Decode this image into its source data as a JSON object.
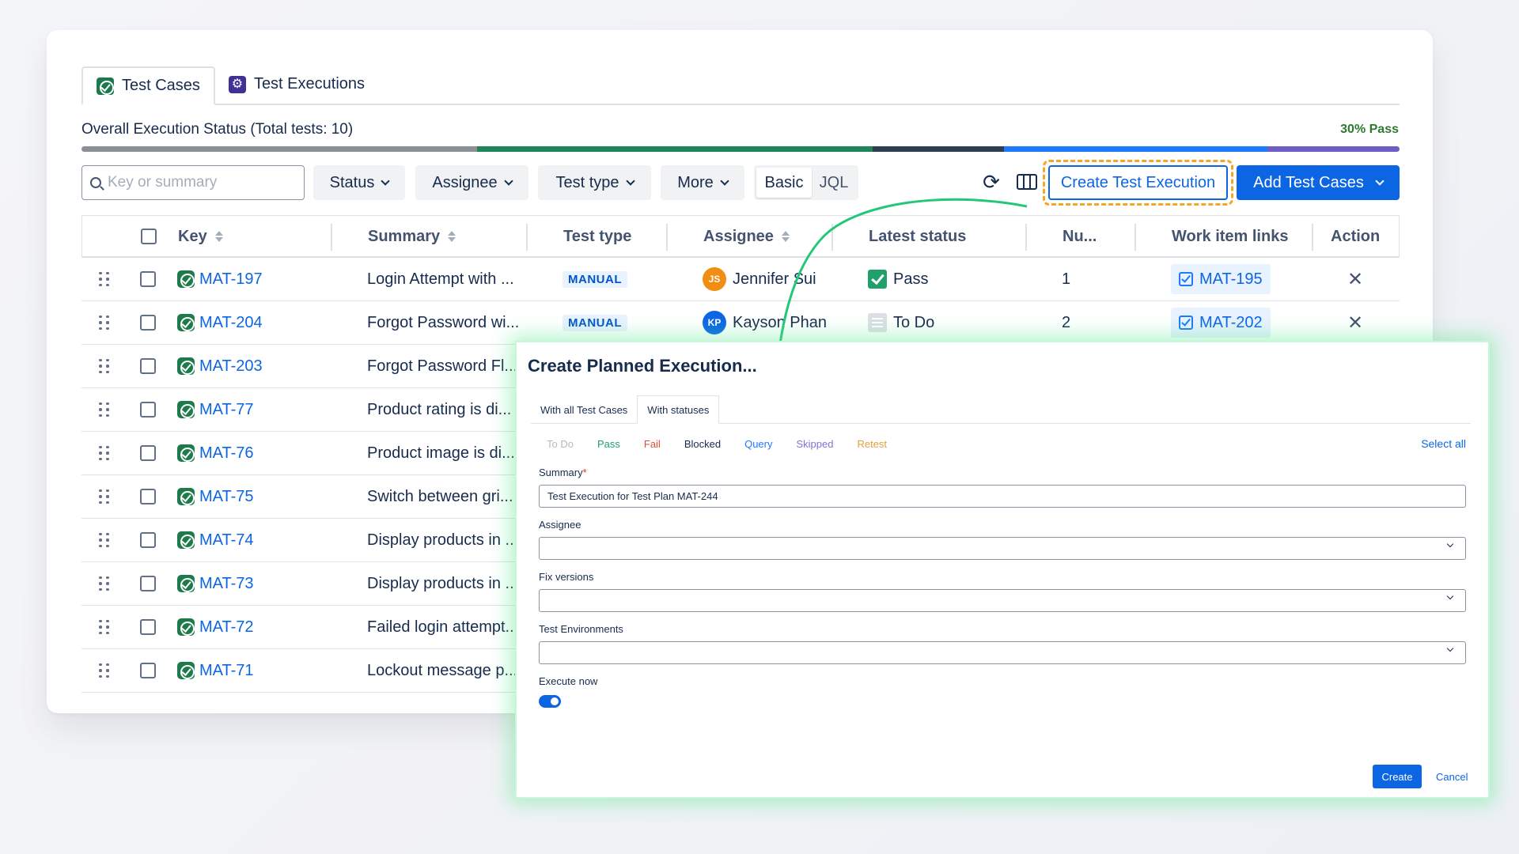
{
  "tabs": [
    {
      "label": "Test Cases"
    },
    {
      "label": "Test Executions"
    }
  ],
  "overall_status": "Overall Execution Status (Total tests: 10)",
  "pass_percent_text": "30% Pass",
  "progress": {
    "segments": [
      {
        "fraction": 0.3,
        "color": "#8c8f96"
      },
      {
        "fraction": 0.3,
        "color": "#1f845a"
      },
      {
        "fraction": 0.1,
        "color": "#2c3e50"
      },
      {
        "fraction": 0.2,
        "color": "#1d7afc"
      },
      {
        "fraction": 0.1,
        "color": "#6e5dc6"
      }
    ]
  },
  "toolbar": {
    "search_placeholder": "Key or summary",
    "status_label": "Status",
    "assignee_label": "Assignee",
    "test_type_label": "Test type",
    "more_label": "More",
    "basic_label": "Basic",
    "jql_label": "JQL",
    "create_execution_label": "Create Test Execution",
    "add_test_cases_label": "Add Test Cases"
  },
  "table": {
    "headers": {
      "key": "Key",
      "summary": "Summary",
      "test_type": "Test type",
      "assignee": "Assignee",
      "latest_status": "Latest status",
      "number": "Nu...",
      "work_item_links": "Work item links",
      "action": "Action"
    },
    "rows": [
      {
        "key": "MAT-197",
        "summary": "Login Attempt with ...",
        "test_type": "MANUAL",
        "assignee_initials": "JS",
        "assignee": "Jennifer Sui",
        "avatar_color": "#f18d13",
        "status": "Pass",
        "number": "1",
        "link": "MAT-195"
      },
      {
        "key": "MAT-204",
        "summary": "Forgot Password wi...",
        "test_type": "MANUAL",
        "assignee_initials": "KP",
        "assignee": "Kayson Phan",
        "avatar_color": "#0c66e4",
        "status": "To Do",
        "number": "2",
        "link": "MAT-202"
      },
      {
        "key": "MAT-203",
        "summary": "Forgot Password Fl..."
      },
      {
        "key": "MAT-77",
        "summary": "Product rating is di..."
      },
      {
        "key": "MAT-76",
        "summary": "Product image is di..."
      },
      {
        "key": "MAT-75",
        "summary": "Switch between gri..."
      },
      {
        "key": "MAT-74",
        "summary": "Display products in ..."
      },
      {
        "key": "MAT-73",
        "summary": "Display products in ..."
      },
      {
        "key": "MAT-72",
        "summary": "Failed login attempt..."
      },
      {
        "key": "MAT-71",
        "summary": "Lockout message p..."
      }
    ]
  },
  "modal": {
    "title": "Create Planned Execution...",
    "tabs": [
      {
        "label": "With all Test Cases"
      },
      {
        "label": "With statuses"
      }
    ],
    "status_chips": [
      {
        "label": "To Do",
        "color": "#b3b9c4"
      },
      {
        "label": "Pass",
        "color": "#22a06b"
      },
      {
        "label": "Fail",
        "color": "#e2483d"
      },
      {
        "label": "Blocked",
        "color": "#172b4d"
      },
      {
        "label": "Query",
        "color": "#1d7afc"
      },
      {
        "label": "Skipped",
        "color": "#8270db"
      },
      {
        "label": "Retest",
        "color": "#e2a03f"
      }
    ],
    "select_all": "Select all",
    "summary_label": "Summary",
    "summary_required": "*",
    "summary_value": "Test Execution for Test Plan MAT-244",
    "assignee_label": "Assignee",
    "fix_versions_label": "Fix versions",
    "test_env_label": "Test Environments",
    "execute_now_label": "Execute now",
    "execute_now": true,
    "create_label": "Create",
    "cancel_label": "Cancel"
  }
}
